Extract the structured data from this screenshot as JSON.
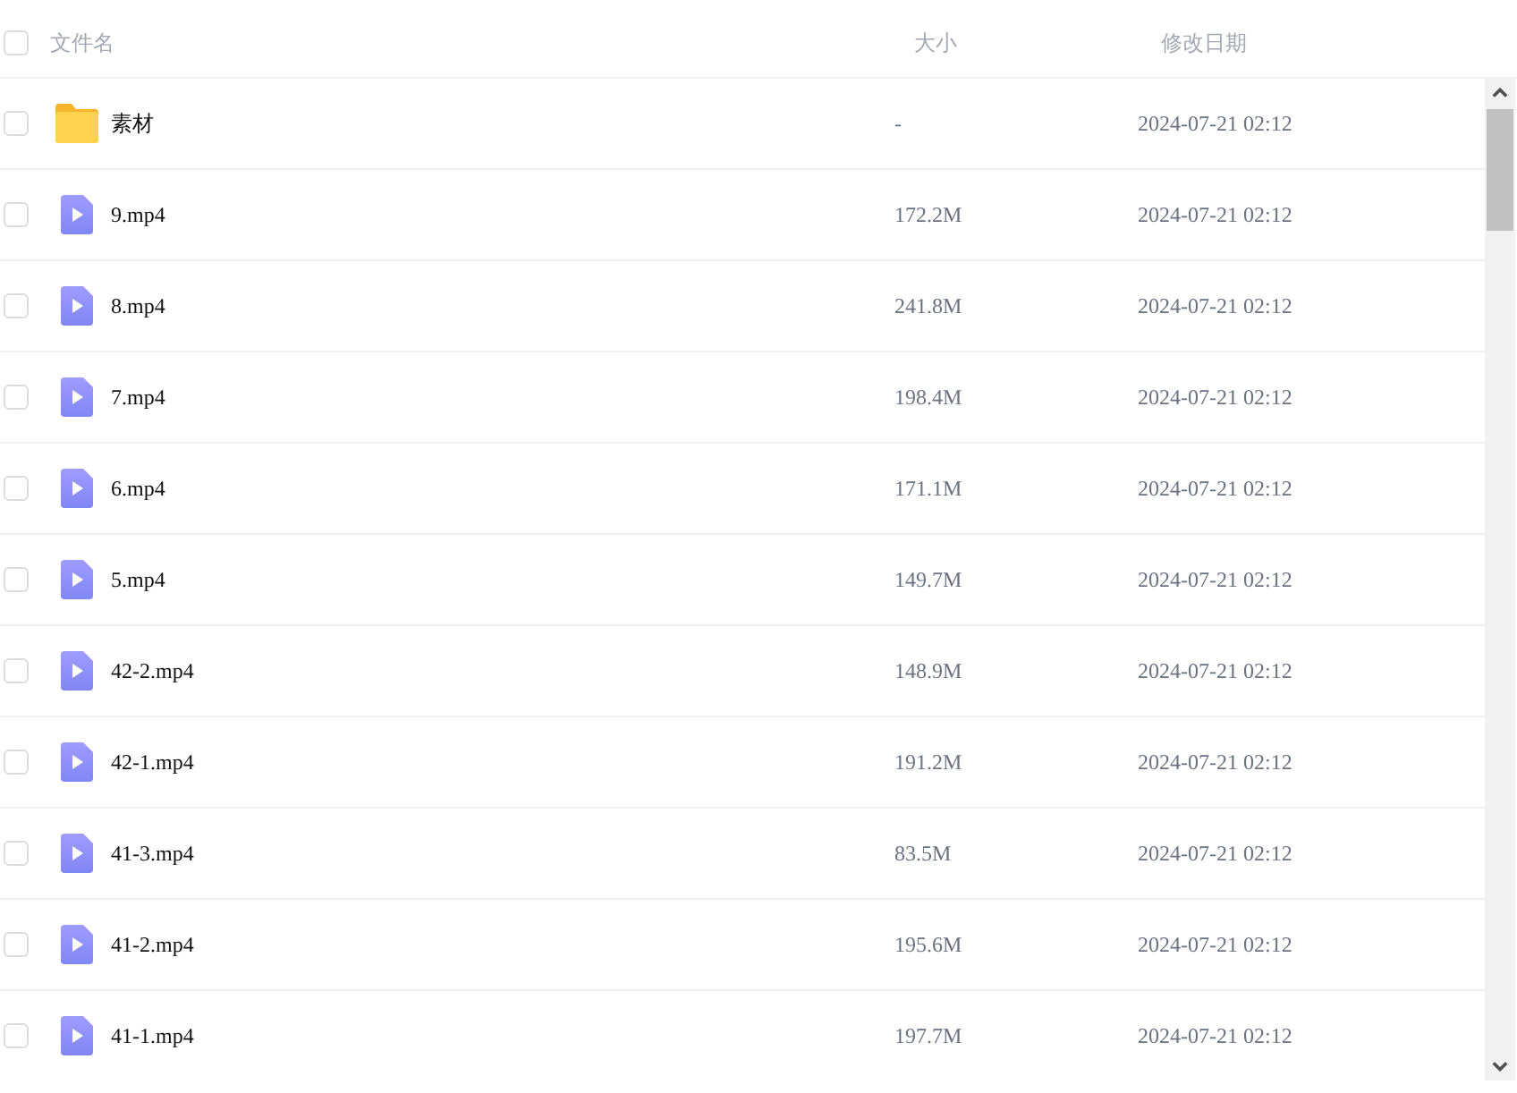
{
  "table": {
    "select_all": {
      "checked": false
    },
    "columns": [
      {
        "label": "文件名"
      },
      {
        "label": "大小"
      },
      {
        "label": "修改日期"
      }
    ],
    "rows": [
      {
        "kind": "folder",
        "name": "素材",
        "size": "-",
        "modified": "2024-07-21 02:12",
        "checked": false
      },
      {
        "kind": "video",
        "name": "9.mp4",
        "size": "172.2M",
        "modified": "2024-07-21 02:12",
        "checked": false
      },
      {
        "kind": "video",
        "name": "8.mp4",
        "size": "241.8M",
        "modified": "2024-07-21 02:12",
        "checked": false
      },
      {
        "kind": "video",
        "name": "7.mp4",
        "size": "198.4M",
        "modified": "2024-07-21 02:12",
        "checked": false
      },
      {
        "kind": "video",
        "name": "6.mp4",
        "size": "171.1M",
        "modified": "2024-07-21 02:12",
        "checked": false
      },
      {
        "kind": "video",
        "name": "5.mp4",
        "size": "149.7M",
        "modified": "2024-07-21 02:12",
        "checked": false
      },
      {
        "kind": "video",
        "name": "42-2.mp4",
        "size": "148.9M",
        "modified": "2024-07-21 02:12",
        "checked": false
      },
      {
        "kind": "video",
        "name": "42-1.mp4",
        "size": "191.2M",
        "modified": "2024-07-21 02:12",
        "checked": false
      },
      {
        "kind": "video",
        "name": "41-3.mp4",
        "size": "83.5M",
        "modified": "2024-07-21 02:12",
        "checked": false
      },
      {
        "kind": "video",
        "name": "41-2.mp4",
        "size": "195.6M",
        "modified": "2024-07-21 02:12",
        "checked": false
      },
      {
        "kind": "video",
        "name": "41-1.mp4",
        "size": "197.7M",
        "modified": "2024-07-21 02:12",
        "checked": false
      }
    ]
  }
}
